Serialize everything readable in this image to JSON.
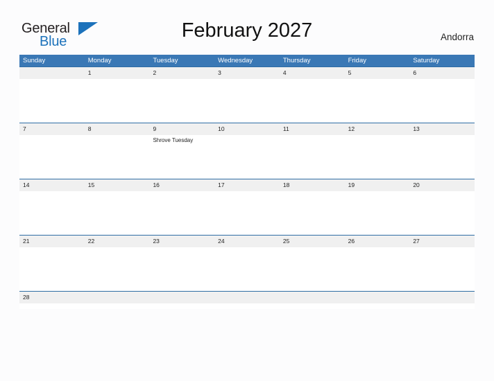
{
  "brand": {
    "name_part1": "General",
    "name_part2": "Blue",
    "flag_icon": "blue-triangle-flag-icon",
    "primary_color": "#1c72bb"
  },
  "header": {
    "title": "February 2027",
    "country": "Andorra"
  },
  "theme": {
    "weekday_header_bg": "#3a78b5",
    "weekday_header_text": "#ffffff",
    "date_band_bg": "#f0f0f0",
    "row_divider": "#2e6da4",
    "page_bg": "#fcfcfd",
    "body_text": "#222222"
  },
  "calendar": {
    "month": "February",
    "year": "2027",
    "weekdays": [
      "Sunday",
      "Monday",
      "Tuesday",
      "Wednesday",
      "Thursday",
      "Friday",
      "Saturday"
    ],
    "weeks": [
      {
        "days": [
          {
            "date": "",
            "events": []
          },
          {
            "date": "1",
            "events": []
          },
          {
            "date": "2",
            "events": []
          },
          {
            "date": "3",
            "events": []
          },
          {
            "date": "4",
            "events": []
          },
          {
            "date": "5",
            "events": []
          },
          {
            "date": "6",
            "events": []
          }
        ]
      },
      {
        "days": [
          {
            "date": "7",
            "events": []
          },
          {
            "date": "8",
            "events": []
          },
          {
            "date": "9",
            "events": [
              "Shrove Tuesday"
            ]
          },
          {
            "date": "10",
            "events": []
          },
          {
            "date": "11",
            "events": []
          },
          {
            "date": "12",
            "events": []
          },
          {
            "date": "13",
            "events": []
          }
        ]
      },
      {
        "days": [
          {
            "date": "14",
            "events": []
          },
          {
            "date": "15",
            "events": []
          },
          {
            "date": "16",
            "events": []
          },
          {
            "date": "17",
            "events": []
          },
          {
            "date": "18",
            "events": []
          },
          {
            "date": "19",
            "events": []
          },
          {
            "date": "20",
            "events": []
          }
        ]
      },
      {
        "days": [
          {
            "date": "21",
            "events": []
          },
          {
            "date": "22",
            "events": []
          },
          {
            "date": "23",
            "events": []
          },
          {
            "date": "24",
            "events": []
          },
          {
            "date": "25",
            "events": []
          },
          {
            "date": "26",
            "events": []
          },
          {
            "date": "27",
            "events": []
          }
        ]
      },
      {
        "days": [
          {
            "date": "28",
            "events": []
          },
          {
            "date": "",
            "events": []
          },
          {
            "date": "",
            "events": []
          },
          {
            "date": "",
            "events": []
          },
          {
            "date": "",
            "events": []
          },
          {
            "date": "",
            "events": []
          },
          {
            "date": "",
            "events": []
          }
        ]
      }
    ]
  }
}
